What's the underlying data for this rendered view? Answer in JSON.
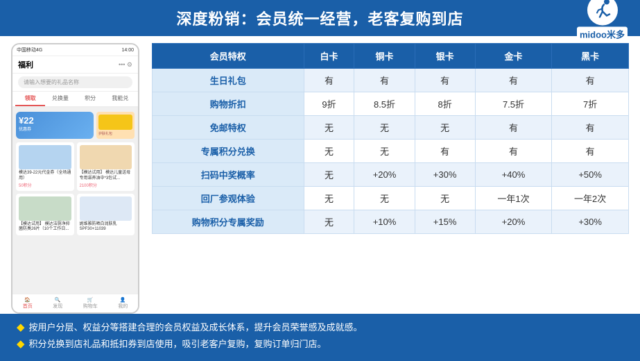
{
  "header": {
    "title": "深度粉销：会员统一经营，老客复购到店"
  },
  "logo": {
    "text": "midoo米多",
    "alt": "midoo logo"
  },
  "phone": {
    "status_bar": "中国移动4G",
    "time": "14:00",
    "nav_title": "福利",
    "search_placeholder": "请输入想要的礼品名称",
    "tabs": [
      "领取",
      "兑换量",
      "积分",
      "我能兑"
    ],
    "active_tab": "领取",
    "coupon_amount": "¥22",
    "coupon_label": "优惠券",
    "product1_name": "模达39-22元代金券（全场通用）",
    "product1_points": "50积分",
    "product2_name": "模达试用] 模达儿童送母专用滋养油中*3包试...",
    "product2_points": "2100积分",
    "product3_name": "模达试用] 模达洁厕净抑菌防臭26片（10个工作日...",
    "product4_name": "妮维雅防晒白润肤乳 SPF30+11039"
  },
  "table": {
    "headers": [
      "会员特权",
      "白卡",
      "铜卡",
      "银卡",
      "金卡",
      "黑卡"
    ],
    "rows": [
      [
        "生日礼包",
        "有",
        "有",
        "有",
        "有",
        "有"
      ],
      [
        "购物折扣",
        "9折",
        "8.5折",
        "8折",
        "7.5折",
        "7折"
      ],
      [
        "免邮特权",
        "无",
        "无",
        "无",
        "有",
        "有"
      ],
      [
        "专属积分兑换",
        "无",
        "无",
        "有",
        "有",
        "有"
      ],
      [
        "扫码中奖概率",
        "无",
        "+20%",
        "+30%",
        "+40%",
        "+50%"
      ],
      [
        "回厂参观体验",
        "无",
        "无",
        "无",
        "一年1次",
        "一年2次"
      ],
      [
        "购物积分专属奖励",
        "无",
        "+10%",
        "+15%",
        "+20%",
        "+30%"
      ]
    ]
  },
  "footer": {
    "items": [
      "按用户分层、权益分等搭建合理的会员权益及成长体系，提升会员荣誉感及成就感。",
      "积分兑换到店礼品和抵扣券到店使用，吸引老客户复购，复购订单归门店。"
    ],
    "bullet": "◆"
  }
}
